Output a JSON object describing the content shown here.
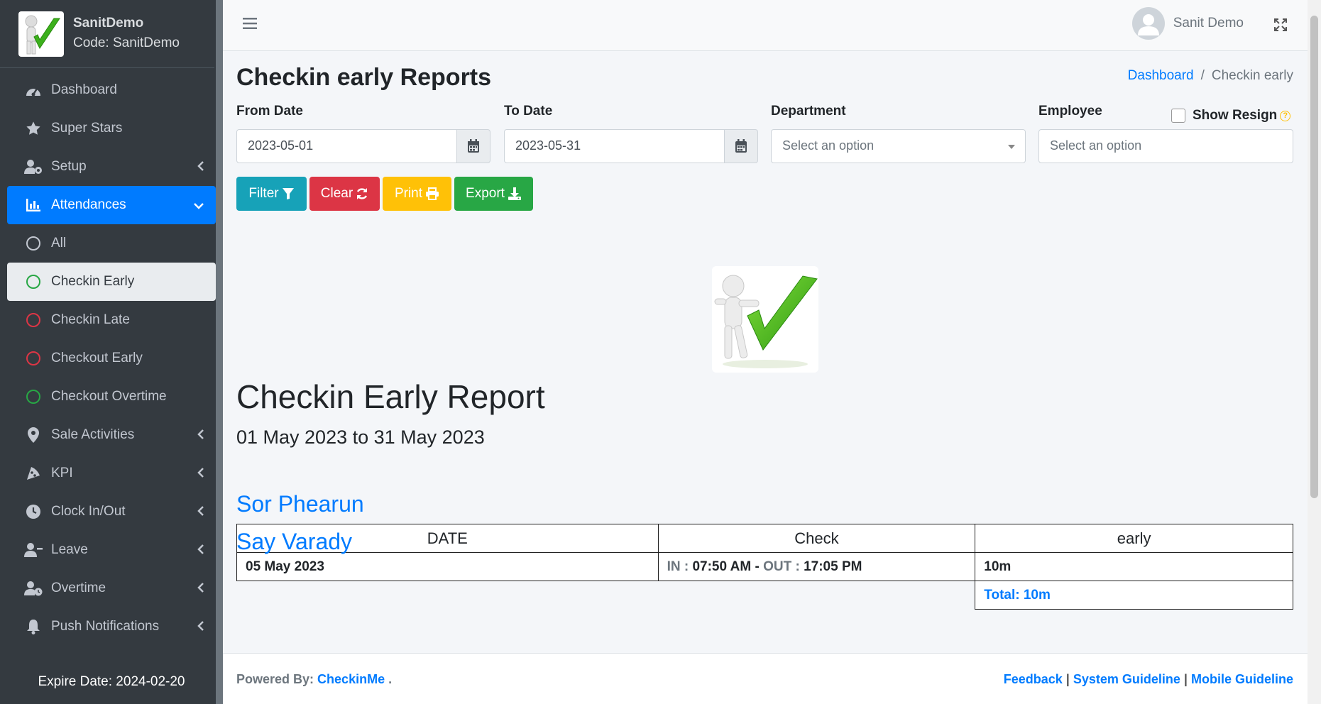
{
  "brand": {
    "name": "SanitDemo",
    "code": "Code: SanitDemo"
  },
  "sidebar": {
    "items": [
      {
        "label": "Dashboard"
      },
      {
        "label": "Super Stars"
      },
      {
        "label": "Setup"
      },
      {
        "label": "Attendances"
      },
      {
        "label": "All"
      },
      {
        "label": "Checkin Early"
      },
      {
        "label": "Checkin Late"
      },
      {
        "label": "Checkout Early"
      },
      {
        "label": "Checkout Overtime"
      },
      {
        "label": "Sale Activities"
      },
      {
        "label": "KPI"
      },
      {
        "label": "Clock In/Out"
      },
      {
        "label": "Leave"
      },
      {
        "label": "Overtime"
      },
      {
        "label": "Push Notifications"
      }
    ],
    "expire": "Expire Date: 2024-02-20"
  },
  "topbar": {
    "user_name": "Sanit Demo"
  },
  "page": {
    "title": "Checkin early Reports",
    "breadcrumb": {
      "home": "Dashboard",
      "current": "Checkin early"
    }
  },
  "filters": {
    "from_label": "From Date",
    "from_value": "2023-05-01",
    "to_label": "To Date",
    "to_value": "2023-05-31",
    "department_label": "Department",
    "department_placeholder": "Select an option",
    "employee_label": "Employee",
    "employee_placeholder": "Select an option",
    "show_resign": "Show Resign"
  },
  "buttons": {
    "filter": "Filter",
    "clear": "Clear",
    "print": "Print",
    "export": "Export"
  },
  "report": {
    "title": "Checkin Early Report",
    "range": "01 May 2023 to 31 May 2023",
    "columns": [
      "DATE",
      "Check",
      "early"
    ],
    "employees": [
      {
        "name": "Sor Phearun",
        "rows": [
          {
            "date": "05 May 2023",
            "in_label": "IN :",
            "in_time": "07:50 AM",
            "dash": "-",
            "out_label": "OUT :",
            "out_time": "17:05 PM",
            "early": "10m"
          }
        ],
        "total": "Total: 10m"
      },
      {
        "name": "Say Varady"
      }
    ]
  },
  "footer": {
    "powered_by": "Powered By:",
    "brand": "CheckinMe",
    "period": ".",
    "links": [
      "Feedback",
      "System Guideline",
      "Mobile Guideline"
    ],
    "separator": "|"
  }
}
